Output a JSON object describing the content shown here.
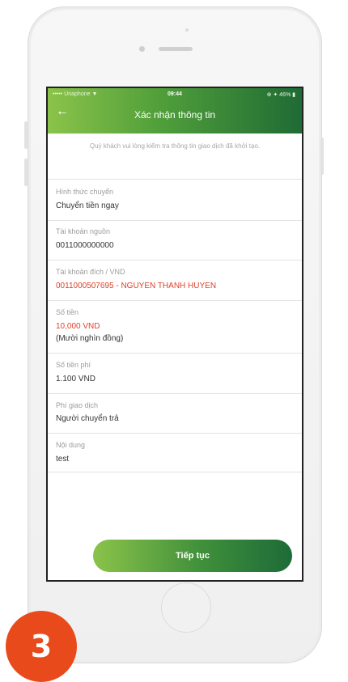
{
  "status_bar": {
    "carrier": "••••• Unaphone ▼",
    "time": "09:44",
    "battery_text": "⊕ ✦ 46% ▮"
  },
  "header": {
    "back_icon": "←",
    "title": "Xác nhận thông tin"
  },
  "notice": "Quý khách vui lòng kiểm tra thông tin giao dịch đã khởi tạo.",
  "fields": {
    "transfer_type": {
      "label": "Hình thức chuyển",
      "value": "Chuyển tiền ngay"
    },
    "source_account": {
      "label": "Tài khoản nguồn",
      "value": "0011000000000"
    },
    "destination_account": {
      "label": "Tài khoản đích / VND",
      "value": "0011000507695 - NGUYEN THANH HUYEN"
    },
    "amount": {
      "label": "Số tiền",
      "value": "10,000 VND",
      "in_words": "(Mười nghìn đồng)"
    },
    "fee_amount": {
      "label": "Số tiền phí",
      "value": "1.100 VND"
    },
    "fee_payer": {
      "label": "Phí giao dịch",
      "value": "Người chuyển trả"
    },
    "content": {
      "label": "Nội dung",
      "value": "test"
    }
  },
  "continue_button": "Tiếp tục",
  "step_badge": "3",
  "colors": {
    "header_gradient": [
      "#8bc34a",
      "#1f6b35"
    ],
    "value_red": "#e0402a",
    "badge": "#e94a1b"
  }
}
